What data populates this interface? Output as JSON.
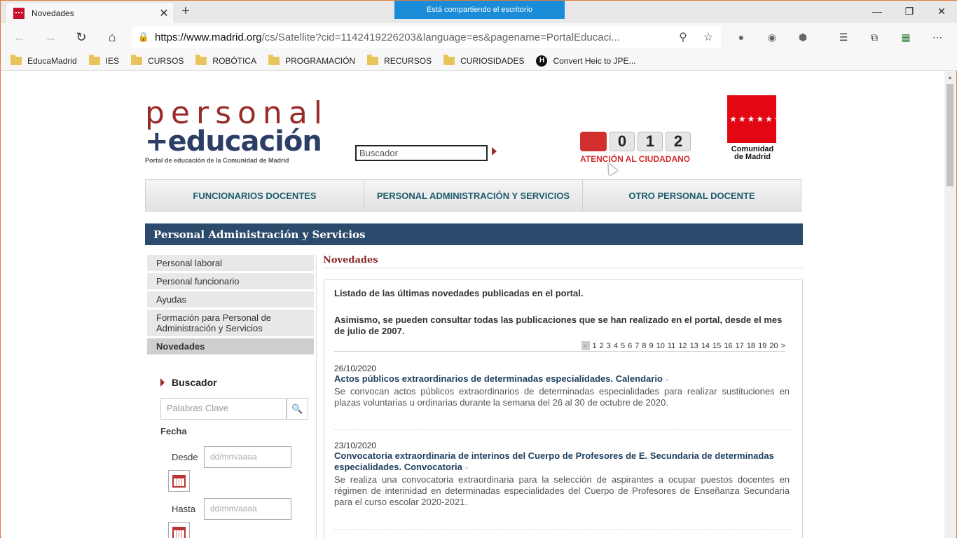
{
  "browser": {
    "tab_title": "Novedades",
    "tab_close": "✕",
    "new_tab": "+",
    "share_banner": "Está compartiendo el escritorio",
    "url_host": "https://www.madrid.org",
    "url_rest": "/cs/Satellite?cid=1142419226203&language=es&pagename=PortalEducaci...",
    "win": {
      "minimize": "—",
      "restore": "❐",
      "close": "✕"
    },
    "nav": {
      "back": "←",
      "forward": "→",
      "refresh": "↻",
      "home": "⌂"
    },
    "bookmarks": [
      "EducaMadrid",
      "IES",
      "CURSOS",
      "ROBÓTICA",
      "PROGRAMACIÓN",
      "RECURSOS",
      "CURIOSIDADES"
    ],
    "bookmark_extra": "Convert Heic to JPE...",
    "bookmark_extra_icon_letter": "H"
  },
  "header": {
    "logo_line1": "personal",
    "logo_line2": "+educación",
    "logo_tagline": "Portal de educación de la Comunidad de Madrid",
    "search_value": "Buscador",
    "badge_digits": [
      "0",
      "1",
      "2"
    ],
    "badge_text": "ATENCIÓN AL CIUDADANO",
    "cm_stars": "★★★★★★★",
    "cm_name_line1": "Comunidad",
    "cm_name_line2": "de Madrid"
  },
  "topnav": [
    "FUNCIONARIOS DOCENTES",
    "PERSONAL ADMINISTRACIÓN Y SERVICIOS",
    "OTRO PERSONAL DOCENTE"
  ],
  "section_title": "Personal Administración y Servicios",
  "sidebar": {
    "items": [
      {
        "label": "Personal laboral"
      },
      {
        "label": "Personal funcionario"
      },
      {
        "label": "Ayudas"
      },
      {
        "label": "Formación para Personal de Administración y Servicios"
      },
      {
        "label": "Novedades",
        "active": true
      }
    ],
    "search_title": "Buscador",
    "keywords_placeholder": "Palabras Clave",
    "fecha_label": "Fecha",
    "desde_label": "Desde",
    "hasta_label": "Hasta",
    "date_placeholder": "dd/mm/aaaa"
  },
  "main": {
    "title": "Novedades",
    "intro1": "Listado de las últimas novedades publicadas en el portal.",
    "intro2": "Asimismo, se pueden consultar todas las publicaciones que se han realizado en el portal, desde el mes de julio de 2007.",
    "pager_pages": [
      "1",
      "2",
      "3",
      "4",
      "5",
      "6",
      "7",
      "8",
      "9",
      "10",
      "11",
      "12",
      "13",
      "14",
      "15",
      "16",
      "17",
      "18",
      "19",
      "20"
    ],
    "pager_next": ">",
    "news": [
      {
        "date": "26/10/2020",
        "title": "Actos públicos extraordinarios de determinadas especialidades. Calendario",
        "desc": "Se convocan actos públicos extraordinarios de determinadas especialidades para realizar sustituciones en plazas voluntarias u ordinarias durante la semana del 26 al 30 de octubre de 2020."
      },
      {
        "date": "23/10/2020",
        "title": "Convocatoria extraordinaria de interinos del Cuerpo de Profesores de E. Secundaria de determinadas especialidades. Convocatoria",
        "desc": "Se realiza una convocatoria extraordinaria para la selección de aspirantes a ocupar puestos docentes en régimen de interinidad en determinadas especialidades del Cuerpo de Profesores de Enseñanza Secundaria para el curso escolar 2020-2021."
      }
    ]
  }
}
